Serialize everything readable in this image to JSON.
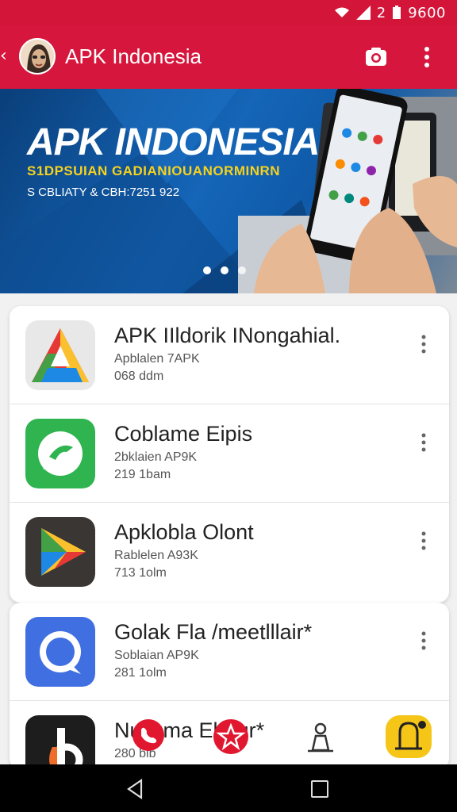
{
  "status_bar": {
    "time": "9600",
    "sim_label": "2"
  },
  "app_bar": {
    "title": "APK Indonesia"
  },
  "banner": {
    "title": "APK INDONESIA",
    "subtitle": "S1DPSUIAN GADIANIOUANORMINRN",
    "tagline": "S CBLIATY & CBH:7251 922"
  },
  "apps": [
    {
      "name": "APK IIldorik INongahial.",
      "meta": "Apblalen 7APK",
      "size": "068 ddm",
      "icon": "triangle-a-icon"
    },
    {
      "name": "Coblame Eipis",
      "meta": "2bklaien AP9K",
      "size": "219 1bam",
      "icon": "chat-bubble-icon"
    },
    {
      "name": "Apklobla Olont",
      "meta": "Rablelen A93K",
      "size": "713 1olm",
      "icon": "play-store-icon"
    },
    {
      "name": "Golak Fla /meetlllair*",
      "meta": "Soblaian AP9K",
      "size": "281 1olm",
      "icon": "message-circle-icon"
    },
    {
      "name": "Nuljama Ebaur*",
      "meta": "280 bib",
      "size": "",
      "icon": "b-letter-icon"
    }
  ],
  "colors": {
    "primary": "#d6163c",
    "status": "#d4153a",
    "accent_yellow": "#f7d21c"
  }
}
